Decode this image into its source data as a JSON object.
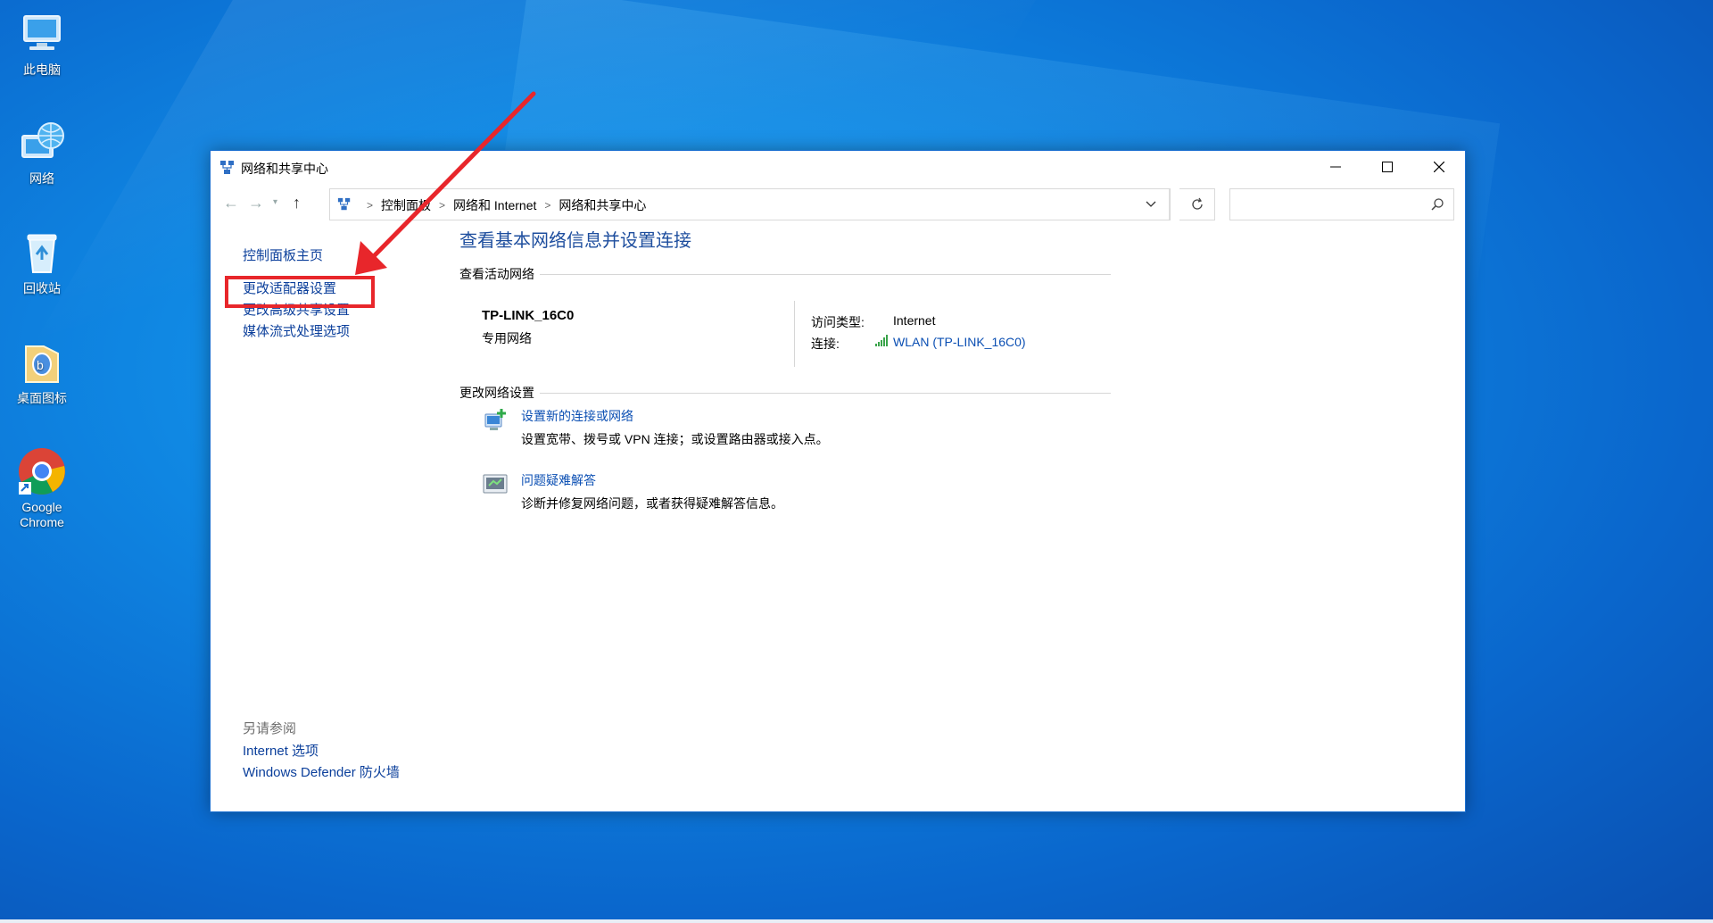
{
  "desktop": {
    "icons": [
      {
        "label": "此电脑",
        "icon": "computer-icon"
      },
      {
        "label": "网络",
        "icon": "network-globe-icon"
      },
      {
        "label": "回收站",
        "icon": "recycle-bin-icon"
      },
      {
        "label": "桌面图标",
        "icon": "folder-icon"
      },
      {
        "label": "Google Chrome",
        "icon": "chrome-icon"
      }
    ]
  },
  "window": {
    "title": "网络和共享中心",
    "breadcrumbs": [
      "控制面板",
      "网络和 Internet",
      "网络和共享中心"
    ],
    "search_placeholder": ""
  },
  "left_pane": {
    "links": [
      "控制面板主页",
      "更改适配器设置",
      "更改高级共享设置",
      "媒体流式处理选项"
    ],
    "see_also_header": "另请参阅",
    "see_also_links": [
      "Internet 选项",
      "Windows Defender 防火墙"
    ]
  },
  "main": {
    "heading": "查看基本网络信息并设置连接",
    "active_networks_label": "查看活动网络",
    "network": {
      "name": "TP-LINK_16C0",
      "type": "专用网络",
      "access_type_label": "访问类型:",
      "access_type_value": "Internet",
      "connection_label": "连接:",
      "connection_value": "WLAN (TP-LINK_16C0)"
    },
    "change_settings_label": "更改网络设置",
    "tasks": [
      {
        "link": "设置新的连接或网络",
        "desc": "设置宽带、拨号或 VPN 连接；或设置路由器或接入点。",
        "icon": "new-connection-icon"
      },
      {
        "link": "问题疑难解答",
        "desc": "诊断并修复网络问题，或者获得疑难解答信息。",
        "icon": "troubleshoot-icon"
      }
    ]
  },
  "annotation": {
    "color": "#e8262b"
  }
}
